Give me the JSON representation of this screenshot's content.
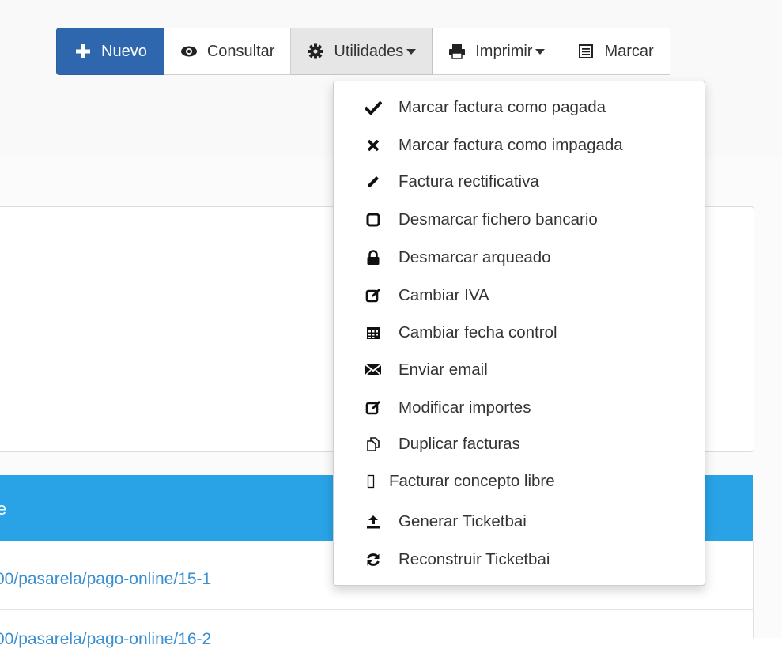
{
  "toolbar": {
    "buttons": [
      {
        "label": "Nuevo",
        "icon": "plus-icon"
      },
      {
        "label": "Consultar",
        "icon": "eye-icon"
      },
      {
        "label": "Utilidades",
        "icon": "gear-icon"
      },
      {
        "label": "Imprimir",
        "icon": "print-icon"
      },
      {
        "label": "Marcar",
        "icon": "list-icon"
      }
    ]
  },
  "dropdown": {
    "items": [
      {
        "label": "Marcar factura como pagada",
        "icon": "check-icon"
      },
      {
        "label": "Marcar factura como impagada",
        "icon": "x-icon"
      },
      {
        "label": "Factura rectificativa",
        "icon": "pencil-icon"
      },
      {
        "label": "Desmarcar fichero bancario",
        "icon": "square-icon"
      },
      {
        "label": "Desmarcar arqueado",
        "icon": "lock-icon"
      },
      {
        "label": "Cambiar IVA",
        "icon": "edit-icon"
      },
      {
        "label": "Cambiar fecha control",
        "icon": "calendar-icon"
      },
      {
        "label": "Enviar email",
        "icon": "envelope-icon"
      },
      {
        "label": "Modificar importes",
        "icon": "edit-icon"
      },
      {
        "label": "Duplicar facturas",
        "icon": "copy-icon"
      },
      {
        "label": "Facturar concepto libre",
        "icon": "empty-box-icon"
      },
      {
        "label": "Generar Ticketbai",
        "icon": "upload-icon"
      },
      {
        "label": "Reconstruir Ticketbai",
        "icon": "refresh-icon"
      }
    ]
  },
  "table": {
    "header_fragment": "e",
    "rows": [
      "00/pasarela/pago-online/15-1",
      "00/pasarela/pago-online/16-2"
    ]
  },
  "colors": {
    "primary": "#2e67ad",
    "table_header": "#29a3e6",
    "link": "#3a8fd0"
  }
}
